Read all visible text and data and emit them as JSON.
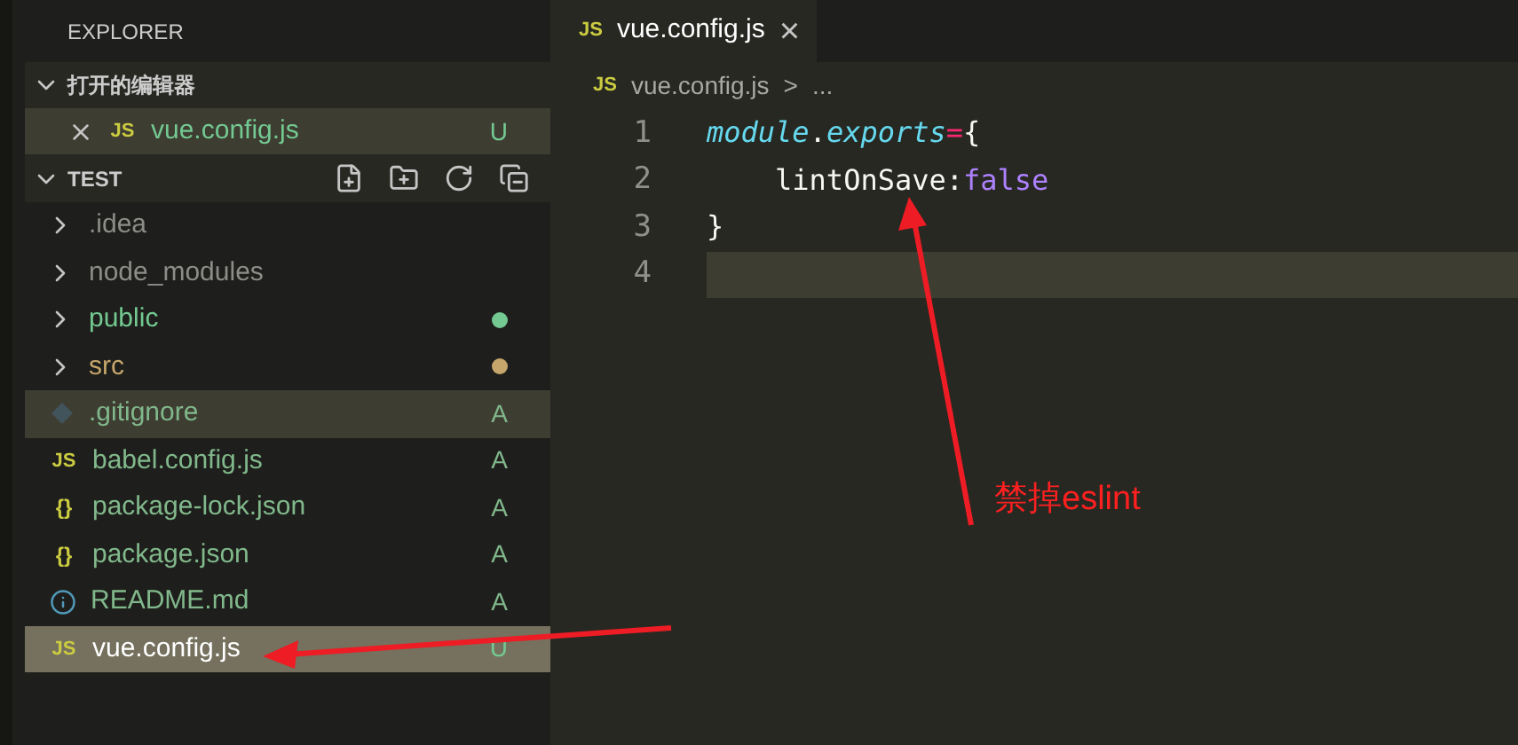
{
  "sidebar": {
    "title": "EXPLORER",
    "open_editors": {
      "label": "打开的编辑器",
      "expanded": true,
      "items": [
        {
          "name": "vue.config.js",
          "icon_text": "JS",
          "kind": "js",
          "color": "#73c991",
          "badge": "U",
          "hovered": true
        }
      ]
    },
    "folder": {
      "label": "TEST",
      "expanded": true,
      "items": [
        {
          "name": ".idea",
          "kind": "folder",
          "color": "#8c8c88",
          "dot": false,
          "selected": false,
          "hovered": false
        },
        {
          "name": "node_modules",
          "kind": "folder",
          "color": "#8c8c88",
          "dot": false,
          "selected": false,
          "hovered": false
        },
        {
          "name": "public",
          "kind": "folder",
          "color": "#73c991",
          "dot": true,
          "selected": false,
          "hovered": false
        },
        {
          "name": "src",
          "kind": "folder",
          "color": "#c6a66b",
          "dot": true,
          "selected": false,
          "hovered": false
        },
        {
          "name": ".gitignore",
          "kind": "git",
          "color": "#81b88b",
          "dot": false,
          "badge": "A",
          "selected": false,
          "hovered": true
        },
        {
          "name": "babel.config.js",
          "kind": "js",
          "icon_text": "JS",
          "color": "#81b88b",
          "dot": false,
          "badge": "A",
          "selected": false,
          "hovered": false
        },
        {
          "name": "package-lock.json",
          "kind": "json",
          "icon_text": "{}",
          "color": "#81b88b",
          "dot": false,
          "badge": "A",
          "selected": false,
          "hovered": false
        },
        {
          "name": "package.json",
          "kind": "json",
          "icon_text": "{}",
          "color": "#81b88b",
          "dot": false,
          "badge": "A",
          "selected": false,
          "hovered": false
        },
        {
          "name": "README.md",
          "kind": "info",
          "color": "#81b88b",
          "dot": false,
          "badge": "A",
          "selected": false,
          "hovered": false
        },
        {
          "name": "vue.config.js",
          "kind": "js",
          "icon_text": "JS",
          "color": "#73c991",
          "dot": false,
          "badge": "U",
          "selected": true,
          "hovered": false
        }
      ]
    }
  },
  "editor": {
    "tab": {
      "icon_text": "JS",
      "label": "vue.config.js",
      "close": "×"
    },
    "breadcrumb": {
      "icon_text": "JS",
      "file": "vue.config.js",
      "separator": ">",
      "more": "..."
    },
    "lines": [
      {
        "number": "1",
        "current": false,
        "tokens": [
          {
            "text": "module",
            "kind": "variable"
          },
          {
            "text": ".",
            "kind": "plain"
          },
          {
            "text": "exports",
            "kind": "variable"
          },
          {
            "text": "=",
            "kind": "operator"
          },
          {
            "text": "{",
            "kind": "plain"
          }
        ]
      },
      {
        "number": "2",
        "current": false,
        "tokens": [
          {
            "text": "    lintOnSave",
            "kind": "plain"
          },
          {
            "text": ":",
            "kind": "plain"
          },
          {
            "text": "false",
            "kind": "constant"
          }
        ]
      },
      {
        "number": "3",
        "current": false,
        "tokens": [
          {
            "text": "}",
            "kind": "plain"
          }
        ]
      },
      {
        "number": "4",
        "current": true
      }
    ]
  },
  "annotation": {
    "text": "禁掉eslint"
  }
}
